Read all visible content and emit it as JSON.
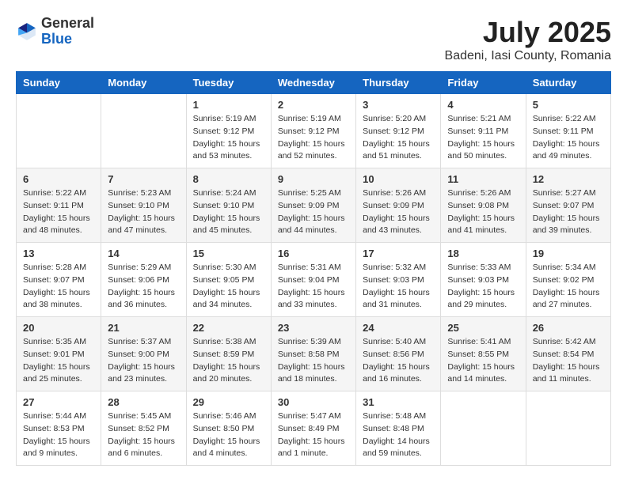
{
  "header": {
    "logo_general": "General",
    "logo_blue": "Blue",
    "month_year": "July 2025",
    "location": "Badeni, Iasi County, Romania"
  },
  "weekdays": [
    "Sunday",
    "Monday",
    "Tuesday",
    "Wednesday",
    "Thursday",
    "Friday",
    "Saturday"
  ],
  "weeks": [
    [
      {
        "day": "",
        "sunrise": "",
        "sunset": "",
        "daylight": ""
      },
      {
        "day": "",
        "sunrise": "",
        "sunset": "",
        "daylight": ""
      },
      {
        "day": "1",
        "sunrise": "Sunrise: 5:19 AM",
        "sunset": "Sunset: 9:12 PM",
        "daylight": "Daylight: 15 hours and 53 minutes."
      },
      {
        "day": "2",
        "sunrise": "Sunrise: 5:19 AM",
        "sunset": "Sunset: 9:12 PM",
        "daylight": "Daylight: 15 hours and 52 minutes."
      },
      {
        "day": "3",
        "sunrise": "Sunrise: 5:20 AM",
        "sunset": "Sunset: 9:12 PM",
        "daylight": "Daylight: 15 hours and 51 minutes."
      },
      {
        "day": "4",
        "sunrise": "Sunrise: 5:21 AM",
        "sunset": "Sunset: 9:11 PM",
        "daylight": "Daylight: 15 hours and 50 minutes."
      },
      {
        "day": "5",
        "sunrise": "Sunrise: 5:22 AM",
        "sunset": "Sunset: 9:11 PM",
        "daylight": "Daylight: 15 hours and 49 minutes."
      }
    ],
    [
      {
        "day": "6",
        "sunrise": "Sunrise: 5:22 AM",
        "sunset": "Sunset: 9:11 PM",
        "daylight": "Daylight: 15 hours and 48 minutes."
      },
      {
        "day": "7",
        "sunrise": "Sunrise: 5:23 AM",
        "sunset": "Sunset: 9:10 PM",
        "daylight": "Daylight: 15 hours and 47 minutes."
      },
      {
        "day": "8",
        "sunrise": "Sunrise: 5:24 AM",
        "sunset": "Sunset: 9:10 PM",
        "daylight": "Daylight: 15 hours and 45 minutes."
      },
      {
        "day": "9",
        "sunrise": "Sunrise: 5:25 AM",
        "sunset": "Sunset: 9:09 PM",
        "daylight": "Daylight: 15 hours and 44 minutes."
      },
      {
        "day": "10",
        "sunrise": "Sunrise: 5:26 AM",
        "sunset": "Sunset: 9:09 PM",
        "daylight": "Daylight: 15 hours and 43 minutes."
      },
      {
        "day": "11",
        "sunrise": "Sunrise: 5:26 AM",
        "sunset": "Sunset: 9:08 PM",
        "daylight": "Daylight: 15 hours and 41 minutes."
      },
      {
        "day": "12",
        "sunrise": "Sunrise: 5:27 AM",
        "sunset": "Sunset: 9:07 PM",
        "daylight": "Daylight: 15 hours and 39 minutes."
      }
    ],
    [
      {
        "day": "13",
        "sunrise": "Sunrise: 5:28 AM",
        "sunset": "Sunset: 9:07 PM",
        "daylight": "Daylight: 15 hours and 38 minutes."
      },
      {
        "day": "14",
        "sunrise": "Sunrise: 5:29 AM",
        "sunset": "Sunset: 9:06 PM",
        "daylight": "Daylight: 15 hours and 36 minutes."
      },
      {
        "day": "15",
        "sunrise": "Sunrise: 5:30 AM",
        "sunset": "Sunset: 9:05 PM",
        "daylight": "Daylight: 15 hours and 34 minutes."
      },
      {
        "day": "16",
        "sunrise": "Sunrise: 5:31 AM",
        "sunset": "Sunset: 9:04 PM",
        "daylight": "Daylight: 15 hours and 33 minutes."
      },
      {
        "day": "17",
        "sunrise": "Sunrise: 5:32 AM",
        "sunset": "Sunset: 9:03 PM",
        "daylight": "Daylight: 15 hours and 31 minutes."
      },
      {
        "day": "18",
        "sunrise": "Sunrise: 5:33 AM",
        "sunset": "Sunset: 9:03 PM",
        "daylight": "Daylight: 15 hours and 29 minutes."
      },
      {
        "day": "19",
        "sunrise": "Sunrise: 5:34 AM",
        "sunset": "Sunset: 9:02 PM",
        "daylight": "Daylight: 15 hours and 27 minutes."
      }
    ],
    [
      {
        "day": "20",
        "sunrise": "Sunrise: 5:35 AM",
        "sunset": "Sunset: 9:01 PM",
        "daylight": "Daylight: 15 hours and 25 minutes."
      },
      {
        "day": "21",
        "sunrise": "Sunrise: 5:37 AM",
        "sunset": "Sunset: 9:00 PM",
        "daylight": "Daylight: 15 hours and 23 minutes."
      },
      {
        "day": "22",
        "sunrise": "Sunrise: 5:38 AM",
        "sunset": "Sunset: 8:59 PM",
        "daylight": "Daylight: 15 hours and 20 minutes."
      },
      {
        "day": "23",
        "sunrise": "Sunrise: 5:39 AM",
        "sunset": "Sunset: 8:58 PM",
        "daylight": "Daylight: 15 hours and 18 minutes."
      },
      {
        "day": "24",
        "sunrise": "Sunrise: 5:40 AM",
        "sunset": "Sunset: 8:56 PM",
        "daylight": "Daylight: 15 hours and 16 minutes."
      },
      {
        "day": "25",
        "sunrise": "Sunrise: 5:41 AM",
        "sunset": "Sunset: 8:55 PM",
        "daylight": "Daylight: 15 hours and 14 minutes."
      },
      {
        "day": "26",
        "sunrise": "Sunrise: 5:42 AM",
        "sunset": "Sunset: 8:54 PM",
        "daylight": "Daylight: 15 hours and 11 minutes."
      }
    ],
    [
      {
        "day": "27",
        "sunrise": "Sunrise: 5:44 AM",
        "sunset": "Sunset: 8:53 PM",
        "daylight": "Daylight: 15 hours and 9 minutes."
      },
      {
        "day": "28",
        "sunrise": "Sunrise: 5:45 AM",
        "sunset": "Sunset: 8:52 PM",
        "daylight": "Daylight: 15 hours and 6 minutes."
      },
      {
        "day": "29",
        "sunrise": "Sunrise: 5:46 AM",
        "sunset": "Sunset: 8:50 PM",
        "daylight": "Daylight: 15 hours and 4 minutes."
      },
      {
        "day": "30",
        "sunrise": "Sunrise: 5:47 AM",
        "sunset": "Sunset: 8:49 PM",
        "daylight": "Daylight: 15 hours and 1 minute."
      },
      {
        "day": "31",
        "sunrise": "Sunrise: 5:48 AM",
        "sunset": "Sunset: 8:48 PM",
        "daylight": "Daylight: 14 hours and 59 minutes."
      },
      {
        "day": "",
        "sunrise": "",
        "sunset": "",
        "daylight": ""
      },
      {
        "day": "",
        "sunrise": "",
        "sunset": "",
        "daylight": ""
      }
    ]
  ]
}
